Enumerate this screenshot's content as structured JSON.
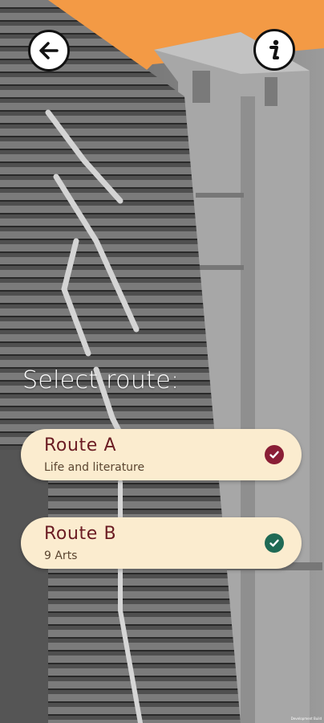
{
  "colors": {
    "sky": "#f39a45",
    "card_bg": "#fbeccf",
    "route_text": "#6b1c23",
    "route_a_check": "#8a1e36",
    "route_b_check": "#1f6a55"
  },
  "header": {
    "back_icon": "arrow-left-icon",
    "info_icon": "info-icon"
  },
  "main": {
    "title": "Select route:",
    "routes": [
      {
        "name": "Route A",
        "subtitle": "Life and literature",
        "check_icon": "check-circle-icon"
      },
      {
        "name": "Route B",
        "subtitle": "9 Arts",
        "check_icon": "check-circle-icon"
      }
    ]
  },
  "footer": {
    "credit": "Development Build"
  }
}
